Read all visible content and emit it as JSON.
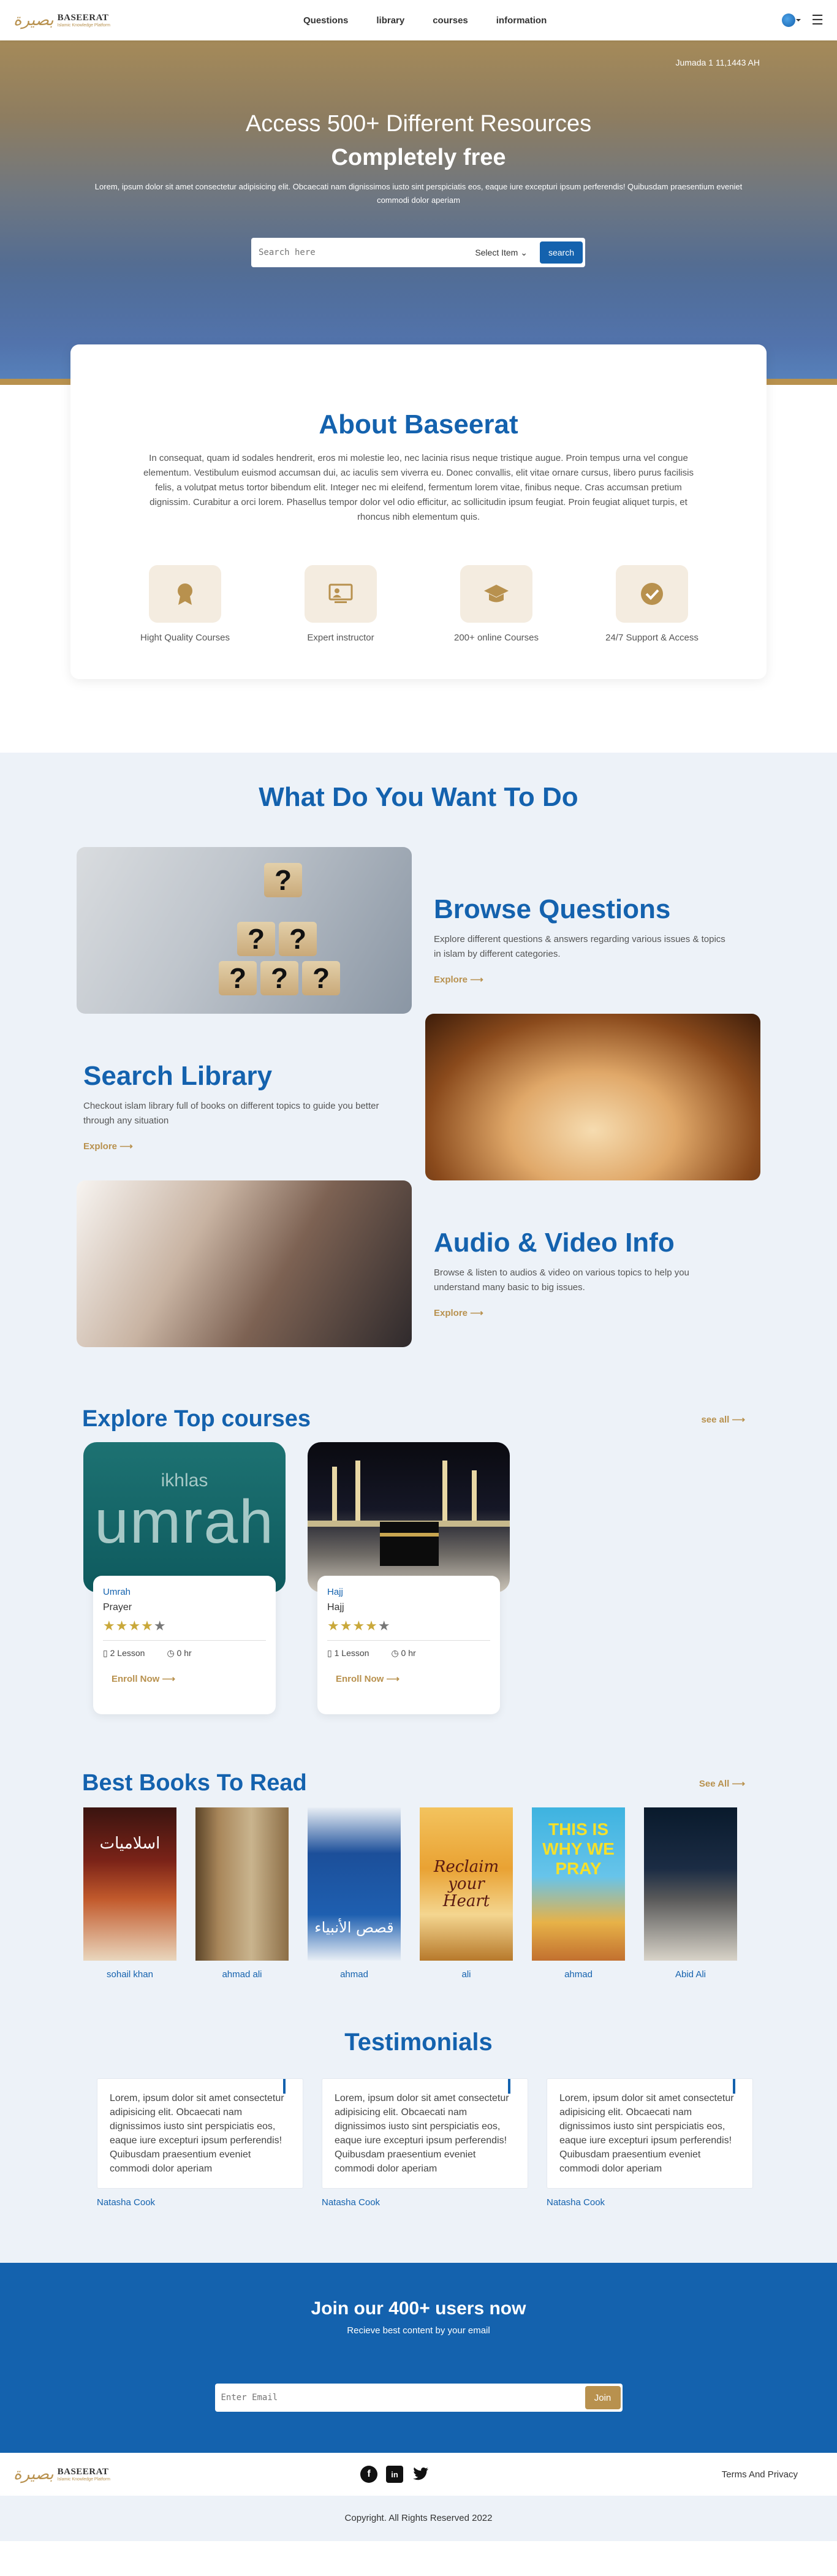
{
  "header": {
    "logo_arabic": "بصيرة",
    "logo_name": "BASEERAT",
    "logo_tagline": "Islamic Knowledge Platform",
    "nav": [
      "Questions",
      "library",
      "courses",
      "information"
    ],
    "menu_glyph": "☰"
  },
  "hero": {
    "date": "Jumada 1 11,1443 AH",
    "title_line1": "Access 500+ Different Resources",
    "title_line2": "Completely free",
    "subtitle": "Lorem, ipsum dolor sit amet consectetur adipisicing elit. Obcaecati nam dignissimos iusto sint perspiciatis eos, eaque iure excepturi ipsum perferendis! Quibusdam praesentium eveniet commodi dolor aperiam",
    "search_placeholder": "Search here",
    "select_label": "Select Item",
    "search_button": "search"
  },
  "about": {
    "title": "About Baseerat",
    "text": "In consequat, quam id sodales hendrerit, eros mi molestie leo, nec lacinia risus neque tristique augue. Proin tempus urna vel congue elementum. Vestibulum euismod accumsan dui, ac iaculis sem viverra eu. Donec convallis, elit vitae ornare cursus, libero purus facilisis felis, a volutpat metus tortor bibendum elit. Integer nec mi eleifend, fermentum lorem vitae, finibus neque. Cras accumsan pretium dignissim. Curabitur a orci lorem. Phasellus tempor dolor vel odio efficitur, ac sollicitudin ipsum feugiat. Proin feugiat aliquet turpis, et rhoncus nibh elementum quis.",
    "features": [
      {
        "icon": "medal-icon",
        "label": "Hight Quality Courses"
      },
      {
        "icon": "instructor-icon",
        "label": "Expert instructor"
      },
      {
        "icon": "graduation-cap-icon",
        "label": "200+ online Courses"
      },
      {
        "icon": "check-badge-icon",
        "label": "24/7 Support & Access"
      }
    ]
  },
  "what": {
    "title": "What Do You Want To Do",
    "items": [
      {
        "title": "Browse Questions",
        "text": "Explore different questions & answers regarding various issues & topics in islam by different categories.",
        "link": "Explore"
      },
      {
        "title": "Search Library",
        "text": "Checkout islam library full of books on different topics to guide you better through any situation",
        "link": "Explore"
      },
      {
        "title": "Audio & Video Info",
        "text": "Browse & listen to audios & video on various topics to help you understand many basic to big issues.",
        "link": "Explore"
      }
    ]
  },
  "courses": {
    "title": "Explore Top courses",
    "see_all": "see all",
    "items": [
      {
        "category": "Umrah",
        "name": "Prayer",
        "rating": 4,
        "lessons": "2 Lesson",
        "hours": "0 hr",
        "enroll": "Enroll Now",
        "cover_small": "ikhlas",
        "cover_big": "umrah"
      },
      {
        "category": "Hajj",
        "name": "Hajj",
        "rating": 4,
        "lessons": "1 Lesson",
        "hours": "0 hr",
        "enroll": "Enroll Now"
      }
    ]
  },
  "books": {
    "title": "Best Books To Read",
    "see_all": "See All",
    "items": [
      {
        "author": "sohail khan",
        "cover_text": "اسلاميات"
      },
      {
        "author": "ahmad ali",
        "cover_text": ""
      },
      {
        "author": "ahmad",
        "cover_text": "قصص الأنبياء"
      },
      {
        "author": "ali",
        "cover_text": "Reclaim your Heart"
      },
      {
        "author": "ahmad",
        "cover_text": "THIS IS WHY WE PRAY"
      },
      {
        "author": "Abid Ali",
        "cover_text": ""
      }
    ]
  },
  "testimonials": {
    "title": "Testimonials",
    "items": [
      {
        "text": "Lorem, ipsum dolor sit amet consectetur adipisicing elit. Obcaecati nam dignissimos iusto sint perspiciatis eos, eaque iure excepturi ipsum perferendis! Quibusdam praesentium eveniet commodi dolor aperiam",
        "name": "Natasha Cook"
      },
      {
        "text": "Lorem, ipsum dolor sit amet consectetur adipisicing elit. Obcaecati nam dignissimos iusto sint perspiciatis eos, eaque iure excepturi ipsum perferendis! Quibusdam praesentium eveniet commodi dolor aperiam",
        "name": "Natasha Cook"
      },
      {
        "text": "Lorem, ipsum dolor sit amet consectetur adipisicing elit. Obcaecati nam dignissimos iusto sint perspiciatis eos, eaque iure excepturi ipsum perferendis! Quibusdam praesentium eveniet commodi dolor aperiam",
        "name": "Natasha Cook"
      }
    ]
  },
  "join": {
    "title": "Join our 400+ users now",
    "subtitle": "Recieve best content by your email",
    "placeholder": "Enter Email",
    "button": "Join"
  },
  "footer": {
    "terms": "Terms And Privacy",
    "copyright": "Copyright. All Rights Reserved 2022"
  },
  "colors": {
    "primary": "#1462ae",
    "accent": "#b8914e",
    "section_bg": "#edf2f8"
  }
}
